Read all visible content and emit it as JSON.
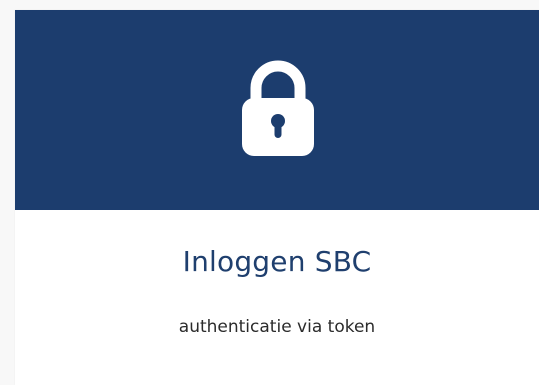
{
  "tile": {
    "title": "Inloggen SBC",
    "subtitle": "authenticatie via token",
    "icon": "lock-icon",
    "header_color": "#1c3d6e",
    "title_color": "#1f3f6e"
  }
}
